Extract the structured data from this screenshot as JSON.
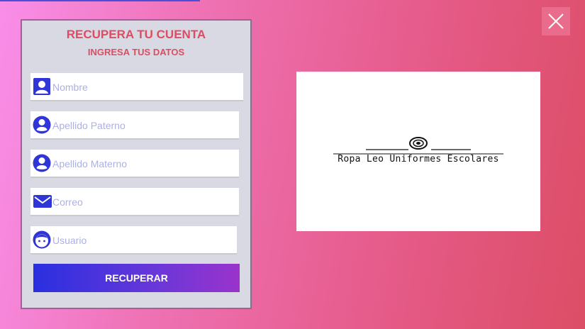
{
  "form": {
    "title": "RECUPERA TU CUENTA",
    "subtitle": "INGRESA TUS DATOS",
    "fields": [
      {
        "placeholder": "Nombre",
        "icon": "person-card-icon"
      },
      {
        "placeholder": "Apellido Paterno",
        "icon": "user-circle-icon"
      },
      {
        "placeholder": "Apellido Materno",
        "icon": "user-circle-icon"
      },
      {
        "placeholder": "Correo",
        "icon": "envelope-icon"
      },
      {
        "placeholder": "Usuario",
        "icon": "face-icon"
      }
    ],
    "button_label": "RECUPERAR"
  },
  "logo": {
    "text": "Ropa Leo Uniformes Escolares"
  },
  "colors": {
    "accent_text": "#de4c63",
    "icon_blue": "#2f35d6",
    "placeholder": "#aab0e8"
  }
}
